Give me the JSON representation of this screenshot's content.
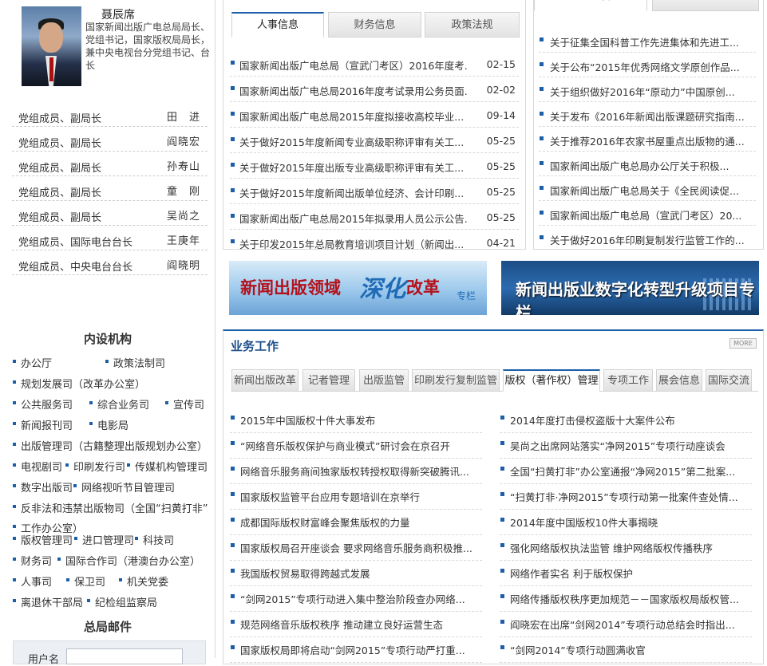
{
  "leader": {
    "name": "聂辰席",
    "title": "国家新闻出版广电总局局长、党组书记，国家版权局局长，兼中央电视台分党组书记、台长"
  },
  "officials": [
    {
      "position": "党组成员、副局长",
      "name": "田　进"
    },
    {
      "position": "党组成员、副局长",
      "name": "阎晓宏"
    },
    {
      "position": "党组成员、副局长",
      "name": "孙寿山"
    },
    {
      "position": "党组成员、副局长",
      "name": "童　刚"
    },
    {
      "position": "党组成员、副局长",
      "name": "吴尚之"
    },
    {
      "position": "党组成员、国际电台台长",
      "name": "王庚年"
    },
    {
      "position": "党组成员、中央电台台长",
      "name": "阎晓明"
    }
  ],
  "departments": {
    "title": "内设机构",
    "items": [
      "办公厅",
      "政策法制司",
      "规划发展司（改革办公室）",
      "公共服务司",
      "综合业务司",
      "宣传司",
      "新闻报刊司",
      "电影局",
      "出版管理司（古籍整理出版规划办公室）",
      "电视剧司",
      "印刷发行司",
      "传媒机构管理司",
      "数字出版司",
      "网络视听节目管理司",
      "反非法和违禁出版物司（全国“扫黄打非”",
      "工作办公室）",
      "版权管理司",
      "进口管理司",
      "科技司",
      "财务司",
      "国际合作司（港澳台办公室）",
      "人事司",
      "保卫司",
      "机关党委",
      "离退休干部局",
      "纪检组监察局"
    ]
  },
  "mail": {
    "title": "总局邮件",
    "user_label": "用户名",
    "user_value": ""
  },
  "news": {
    "tabs": [
      "人事信息",
      "财务信息",
      "政策法规"
    ],
    "active_tab": 0,
    "items": [
      {
        "title": "国家新闻出版广电总局（宣武门考区）2016年度考...",
        "date": "02-15"
      },
      {
        "title": "国家新闻出版广电总局2016年度考试录用公务员面...",
        "date": "02-02"
      },
      {
        "title": "国家新闻出版广电总局2015年度拟接收高校毕业...",
        "date": "09-14"
      },
      {
        "title": "关于做好2015年度新闻专业高级职称评审有关工...",
        "date": "05-25"
      },
      {
        "title": "关于做好2015年度出版专业高级职称评审有关工...",
        "date": "05-25"
      },
      {
        "title": "关于做好2015年度新闻出版单位经济、会计印刷...",
        "date": "05-25"
      },
      {
        "title": "国家新闻出版广电总局2015年拟录用人员公示公告...",
        "date": "05-25"
      },
      {
        "title": "关于印发2015年总局教育培训项目计划（新闻出...",
        "date": "04-21"
      }
    ]
  },
  "announce": {
    "tabs": [
      "通知公告",
      "网上公示"
    ],
    "items": [
      "关于征集全国科普工作先进集体和先进工...",
      "关于公布“2015年优秀网络文学原创作品...",
      "关于组织做好2016年“原动力”中国原创...",
      "关于发布《2016年新闻出版课题研究指南...",
      "关于推荐2016年农家书屋重点出版物的通...",
      "国家新闻出版广电总局办公厅关于积极...",
      "国家新闻出版广电总局关于《全民阅读促...",
      "国家新闻出版广电总局（宣武门考区）20...",
      "关于做好2016年印刷复制发行监管工作的..."
    ]
  },
  "banners": {
    "reform": {
      "part1": "新闻出版领域",
      "part2": "深化",
      "part3": "改革",
      "part4": "专栏"
    },
    "digital": "新闻出版业数字化转型升级项目专栏"
  },
  "business": {
    "title": "业务工作",
    "more": "MORE",
    "tabs": [
      "新闻出版改革",
      "记者管理",
      "出版监管",
      "印刷发行复制监管",
      "版权（著作权）管理",
      "专项工作",
      "展会信息",
      "国际交流"
    ],
    "active_tab": 4,
    "left_items": [
      "2015年中国版权十件大事发布",
      "“网络音乐版权保护与商业模式”研讨会在京召开",
      "网络音乐服务商间独家版权转授权取得新突破腾讯...",
      "国家版权监管平台应用专题培训在京举行",
      "成都国际版权财富峰会聚焦版权的力量",
      "国家版权局召开座谈会 要求网络音乐服务商积极推...",
      "我国版权贸易取得跨越式发展",
      "“剑网2015”专项行动进入集中整治阶段查办网络...",
      "规范网络音乐版权秩序 推动建立良好运营生态",
      "国家版权局即将启动“剑网2015”专项行动严打重..."
    ],
    "right_items": [
      "2014年度打击侵权盗版十大案件公布",
      "吴尚之出席网站落实“净网2015”专项行动座谈会",
      "全国“扫黄打非”办公室通报“净网2015”第二批案...",
      "“扫黄打非·净网2015”专项行动第一批案件查处情...",
      "2014年度中国版权10件大事揭晓",
      "强化网络版权执法监管 维护网络版权传播秩序",
      "网络作者实名 利于版权保护",
      "网络传播版权秩序更加规范－－国家版权局版权管...",
      "阎晓宏在出席“剑网2014”专项行动总结会时指出...",
      "“剑网2014”专项行动圆满收官"
    ]
  },
  "colors": {
    "accent": "#1d5ea8",
    "reform_red": "#b3121c"
  }
}
